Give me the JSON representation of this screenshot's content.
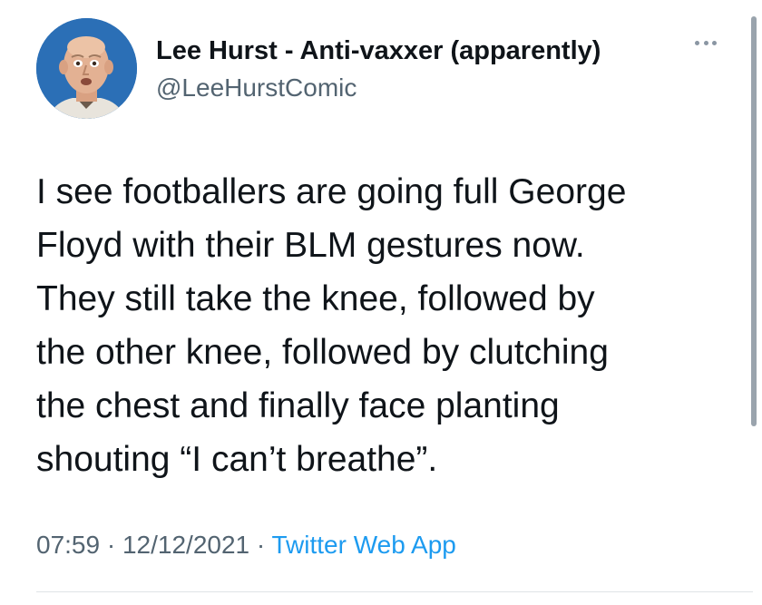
{
  "author": {
    "display_name": "Lee Hurst - Anti-vaxxer (apparently)",
    "handle": "@LeeHurstComic"
  },
  "tweet": {
    "lines": [
      "I see footballers are going full George",
      "Floyd with their BLM gestures now.",
      "They still take the knee, followed by",
      "the other knee, followed by clutching",
      "the chest and finally face planting",
      "shouting “I can’t breathe”."
    ]
  },
  "meta": {
    "time": "07:59",
    "separator1": " · ",
    "date": "12/12/2021",
    "separator2": " · ",
    "source": "Twitter Web App"
  },
  "icons": {
    "more": "more-options-icon"
  },
  "colors": {
    "text": "#0f1419",
    "secondary": "#536471",
    "link": "#1d9bf0",
    "avatar_bg": "#2b6fb6"
  }
}
